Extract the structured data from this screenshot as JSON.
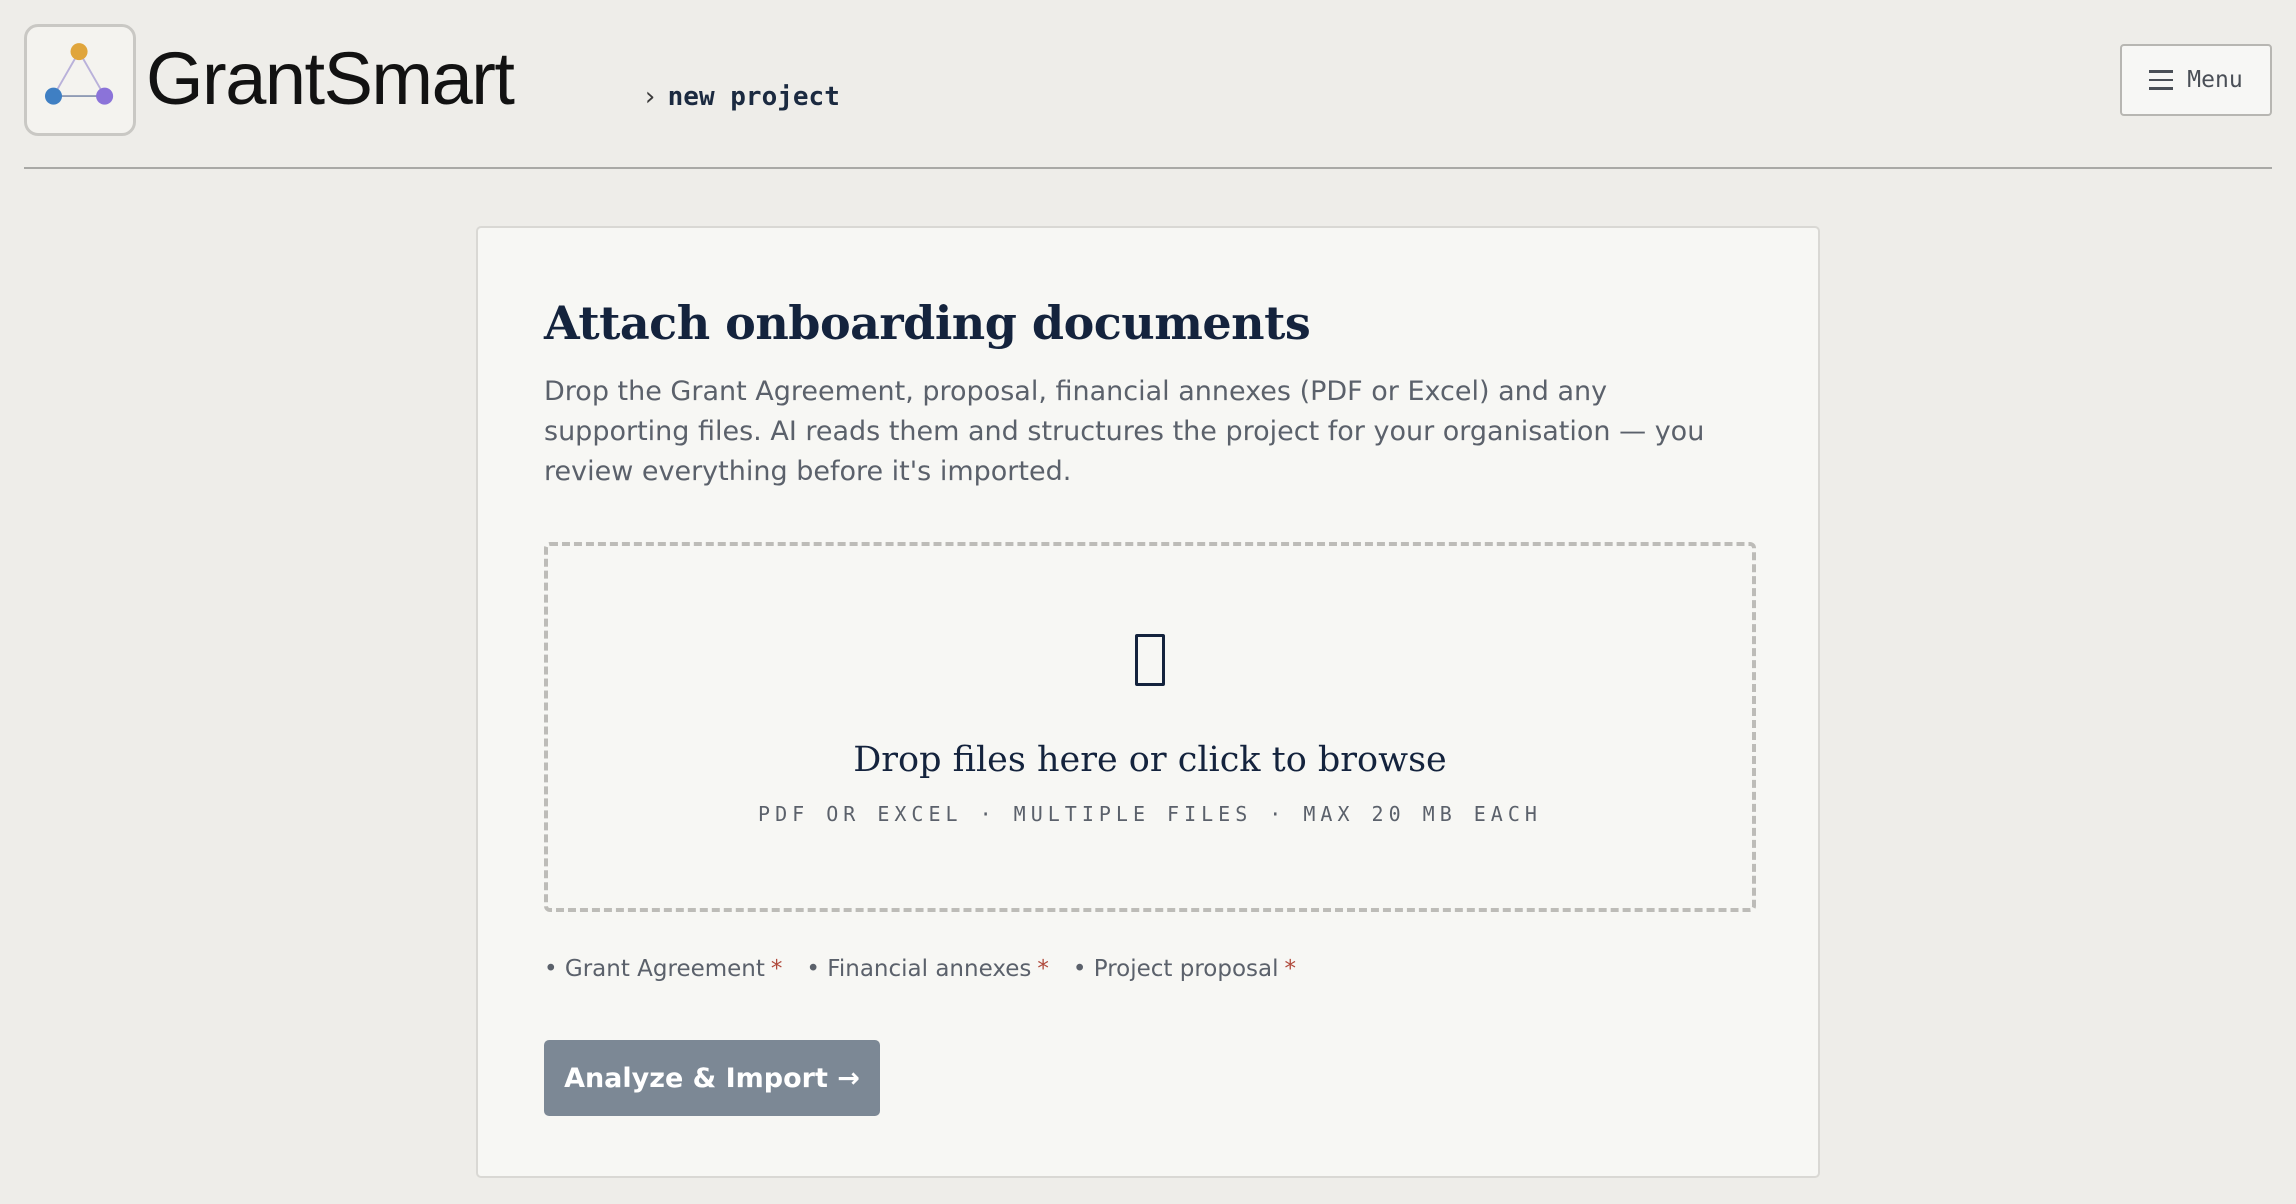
{
  "app": {
    "name": "GrantSmart",
    "logo_icon": "triangle-network-icon",
    "logo_colors": [
      "#e0a53c",
      "#3f7fc3",
      "#8b73d9"
    ]
  },
  "breadcrumb": {
    "separator": "›",
    "current": "new project"
  },
  "header": {
    "menu_label": "Menu",
    "menu_icon": "hamburger-icon"
  },
  "card": {
    "title": "Attach onboarding documents",
    "description": "Drop the Grant Agreement, proposal, financial annexes (PDF or Excel) and any supporting files. AI reads them and structures the project for your organisation — you review everything before it's imported.",
    "dropzone": {
      "icon": "document-icon",
      "title": "Drop files here or click to browse",
      "hint": "PDF or Excel · Multiple files · Max 20 MB each"
    },
    "required_docs": [
      {
        "bullet": "•",
        "label": "Grant Agreement",
        "mark": "*"
      },
      {
        "bullet": "•",
        "label": "Financial annexes",
        "mark": "*"
      },
      {
        "bullet": "•",
        "label": "Project proposal",
        "mark": "*"
      }
    ],
    "import_button": "Analyze & Import →"
  },
  "colors": {
    "background": "#eeede9",
    "card": "#f7f7f4",
    "heading": "#14233d",
    "button_disabled": "#7c8895",
    "required_star": "#b04a3c"
  }
}
